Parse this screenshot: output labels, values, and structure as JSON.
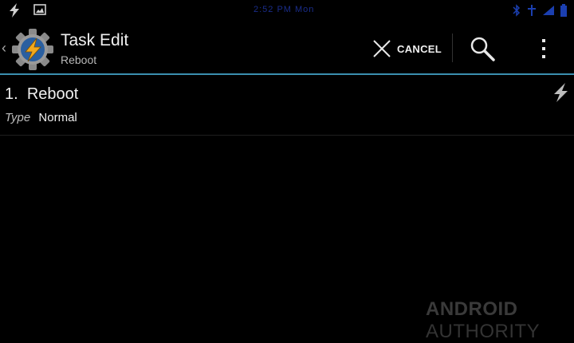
{
  "statusbar": {
    "clock": "2:52 PM Mon",
    "left_icons": [
      "tasker-bolt-icon",
      "image-icon"
    ],
    "right_icons": [
      "bluetooth-icon",
      "signal-icon",
      "wifi-icon",
      "battery-icon"
    ]
  },
  "actionbar": {
    "title": "Task Edit",
    "subtitle": "Reboot",
    "cancel_label": "CANCEL",
    "accent_color": "#3b8fb0"
  },
  "actions": [
    {
      "number": "1.",
      "name": "Reboot",
      "type_key": "Type",
      "type_value": "Normal"
    }
  ],
  "watermark": {
    "bold": "ANDROID",
    "light": "AUTHORITY"
  }
}
